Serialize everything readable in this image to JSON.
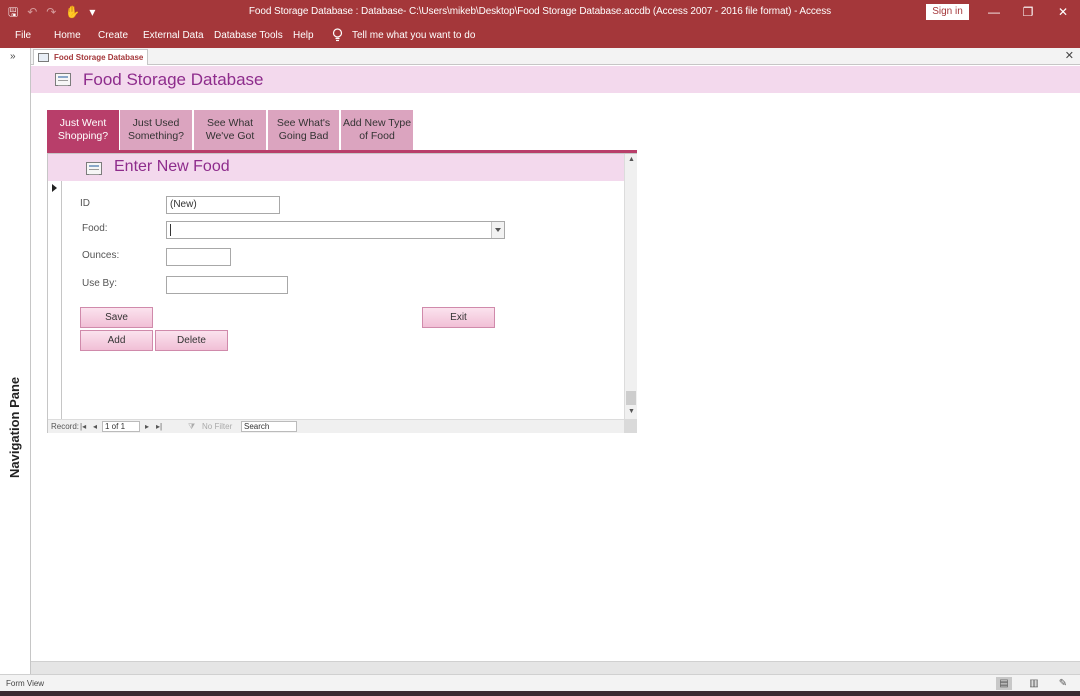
{
  "window": {
    "title": "Food Storage Database : Database- C:\\Users\\mikeb\\Desktop\\Food Storage Database.accdb (Access 2007 - 2016 file format)  -  Access",
    "sign_in": "Sign in",
    "min": "—",
    "restore": "❐",
    "close": "✕"
  },
  "qat": {
    "save": "🖫",
    "undo": "↶",
    "redo": "↷",
    "touch": "✋",
    "customize": "▾"
  },
  "menu": {
    "file": "File",
    "home": "Home",
    "create": "Create",
    "external": "External Data",
    "dbtools": "Database Tools",
    "help": "Help",
    "tell": "Tell me what you want to do"
  },
  "nav": {
    "toggle": "»",
    "label": "Navigation Pane"
  },
  "doc_tab": {
    "label": "Food Storage Database",
    "close": "✕"
  },
  "form": {
    "title": "Food Storage Database"
  },
  "tabs": [
    {
      "line1": "Just Went",
      "line2": "Shopping?"
    },
    {
      "line1": "Just Used",
      "line2": "Something?"
    },
    {
      "line1": "See What",
      "line2": "We've Got"
    },
    {
      "line1": "See What's",
      "line2": "Going Bad"
    },
    {
      "line1": "Add New Type",
      "line2": "of Food"
    }
  ],
  "subform": {
    "title": "Enter New Food",
    "id_label": "ID",
    "id_value": "(New)",
    "food_label": "Food:",
    "food_value": "",
    "ounces_label": "Ounces:",
    "ounces_value": "",
    "useby_label": "Use By:",
    "useby_value": "",
    "save": "Save",
    "add": "Add",
    "delete": "Delete",
    "exit": "Exit"
  },
  "record_nav": {
    "label": "Record:",
    "first": "|◂",
    "prev": "◂",
    "position": "1 of 1",
    "next": "▸",
    "last": "▸|",
    "filter": "No Filter",
    "search": "Search"
  },
  "status": {
    "text": "Form View"
  }
}
